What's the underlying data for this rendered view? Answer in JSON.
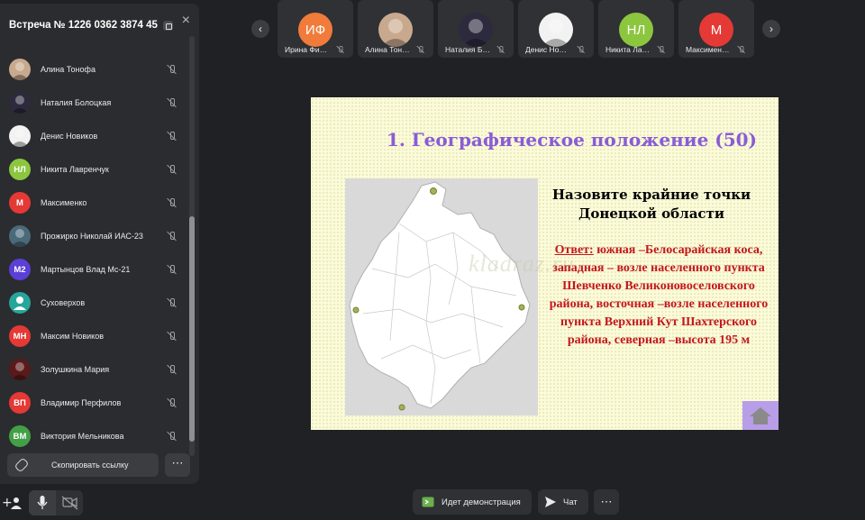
{
  "panel": {
    "title": "Встреча № 1226 0362 3874 45",
    "close": "×",
    "participants": [
      {
        "name": "Алина Тонофа",
        "avatar_type": "photo",
        "color": "#c9a98e"
      },
      {
        "name": "Наталия Болоцкая",
        "avatar_type": "photo",
        "color": "#2d2a3e"
      },
      {
        "name": "Денис Новиков",
        "avatar_type": "photo",
        "color": "#f2f2f2"
      },
      {
        "name": "Никита Лавренчук",
        "initials": "НЛ",
        "color": "#8cc63f"
      },
      {
        "name": "Максименко",
        "initials": "М",
        "color": "#e53935"
      },
      {
        "name": "Прожирко Николай ИАС-23",
        "avatar_type": "photo",
        "color": "#4a6a7a"
      },
      {
        "name": "Мартынцов Влад Мс-21",
        "initials": "М2",
        "color": "#5b3fd6"
      },
      {
        "name": "Суховерхов",
        "avatar_type": "person-icon",
        "color": "#26a69a"
      },
      {
        "name": "Максим Новиков",
        "initials": "МН",
        "color": "#e53935"
      },
      {
        "name": "Золушкина Мария",
        "avatar_type": "photo",
        "color": "#5a1a1a"
      },
      {
        "name": "Владимир Перфилов",
        "initials": "ВП",
        "color": "#e53935"
      },
      {
        "name": "Виктория Мельникова",
        "initials": "ВМ",
        "color": "#43a047"
      }
    ],
    "copy_link_label": "Скопировать ссылку",
    "more_label": "⋯"
  },
  "strip": {
    "prev": "‹",
    "next": "›",
    "tiles": [
      {
        "label": "Ирина Фи…",
        "initials": "ИФ",
        "color": "#f07b3a"
      },
      {
        "label": "Алина Тон…",
        "initials": "",
        "color": "#c9a98e"
      },
      {
        "label": "Наталия Б…",
        "initials": "",
        "color": "#2d2a3e"
      },
      {
        "label": "Денис Но…",
        "initials": "",
        "color": "#f2f2f2"
      },
      {
        "label": "Никита Ла…",
        "initials": "НЛ",
        "color": "#8cc63f"
      },
      {
        "label": "Максимен…",
        "initials": "М",
        "color": "#e53935"
      }
    ]
  },
  "slide": {
    "title": "1. Географическое положение  (50)",
    "question": "Назовите крайние точки Донецкой области",
    "answer_label": "Ответ:",
    "answer_text": " южная  –Белосарайская коса, западная  –  возле населенного пункта Шевченко Великоновоселовского района, восточная –возле населенного пункта Верхний Кут Шахтерского района, северная –высота 195 м",
    "watermark": "kladraz.ru"
  },
  "bottom": {
    "demo_label": "Идет демонстрация",
    "chat_label": "Чат",
    "more_label": "⋯"
  }
}
